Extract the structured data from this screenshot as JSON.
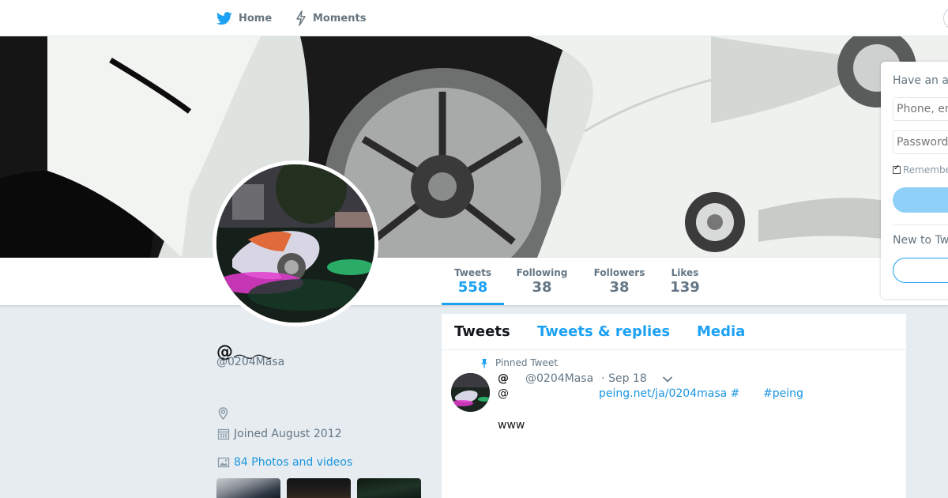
{
  "nav": {
    "home_label": "Home",
    "moments_label": "Moments",
    "icons": [
      "twitter-bird-icon",
      "moments-bolt-icon"
    ]
  },
  "colors": {
    "accent": "#1da1f2",
    "link": "#1b95e0",
    "background": "#e6ecf0",
    "muted_text": "#657786"
  },
  "profile": {
    "name": "@𓂃𓂃",
    "handle": "@0204Masa",
    "joined": "Joined August 2012",
    "photos_link": "84 Photos and videos"
  },
  "stats": [
    {
      "label": "Tweets",
      "value": "558",
      "active": true
    },
    {
      "label": "Following",
      "value": "38",
      "active": false
    },
    {
      "label": "Followers",
      "value": "38",
      "active": false
    },
    {
      "label": "Likes",
      "value": "139",
      "active": false
    }
  ],
  "timeline": {
    "tabs": [
      {
        "label": "Tweets",
        "active": true
      },
      {
        "label": "Tweets & replies",
        "active": false
      },
      {
        "label": "Media",
        "active": false
      }
    ],
    "pinned_label": "Pinned Tweet",
    "tweet": {
      "name": "@",
      "handle": "@0204Masa",
      "date": "· Sep 18",
      "line2_prefix": "@",
      "link": "peing.net/ja/0204masa #",
      "hashtag": "#peing",
      "body": "www"
    }
  },
  "login": {
    "title": "Have an a",
    "phone_placeholder": "Phone, em",
    "password_placeholder": "Password",
    "remember_label": "Remembe",
    "remember_checked": true,
    "new_to": "New to Tw"
  }
}
